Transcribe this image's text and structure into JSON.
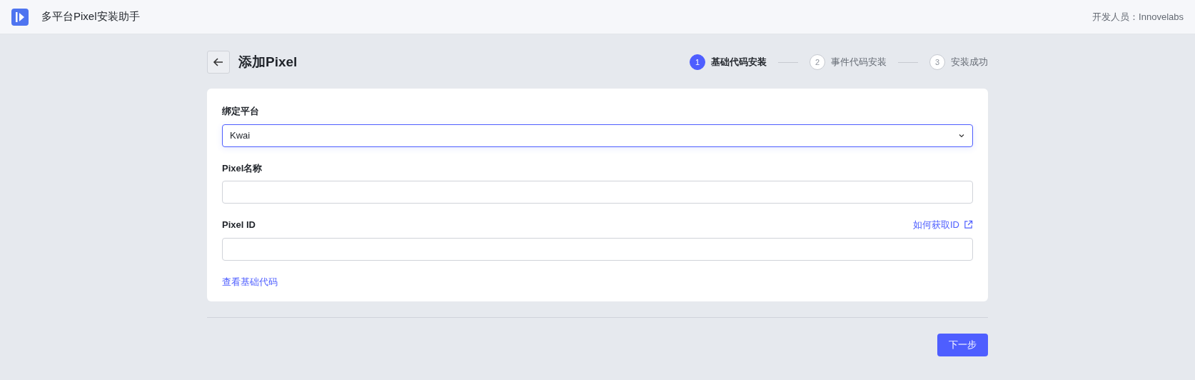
{
  "header": {
    "app_title": "多平台Pixel安装助手",
    "developer": "开发人员：Innovelabs"
  },
  "page": {
    "title": "添加Pixel"
  },
  "steps": [
    {
      "number": "1",
      "label": "基础代码安装",
      "selected": true
    },
    {
      "number": "2",
      "label": "事件代码安装",
      "selected": false
    },
    {
      "number": "3",
      "label": "安装成功",
      "selected": false
    }
  ],
  "form": {
    "fields": [
      {
        "kind": "select",
        "label": "绑定平台",
        "value": "Kwai",
        "focused": true
      },
      {
        "kind": "text",
        "label": "Pixel名称",
        "focused": false
      },
      {
        "kind": "text",
        "label": "Pixel ID",
        "help_link": "如何获取ID",
        "focused": false
      }
    ],
    "code_link": "查看基础代码"
  },
  "buttons": {
    "next": "下一步"
  }
}
